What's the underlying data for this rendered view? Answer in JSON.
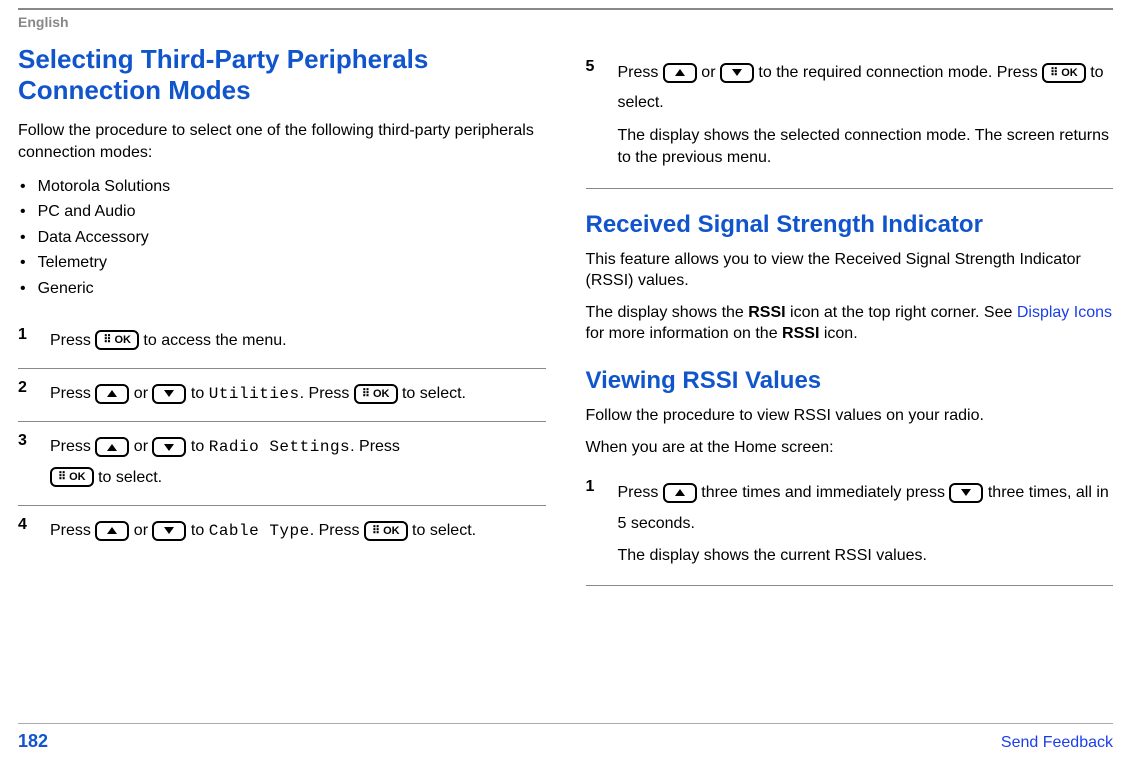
{
  "header": {
    "language": "English"
  },
  "left": {
    "h1_line1": "Selecting Third-Party Peripherals",
    "h1_line2": "Connection Modes",
    "intro": "Follow the procedure to select one of the following third-party peripherals connection modes:",
    "bullets": [
      "Motorola Solutions",
      "PC and Audio",
      "Data Accessory",
      "Telemetry",
      "Generic"
    ],
    "steps": {
      "s1": {
        "num": "1",
        "pre": "Press ",
        "ok": "⠿ OK",
        "post": " to access the menu."
      },
      "s2": {
        "num": "2",
        "pre": "Press ",
        "mid": " or ",
        "to": " to ",
        "menu": "Utilities",
        "dotpress": ". Press ",
        "ok": "⠿ OK",
        "post": " to select."
      },
      "s3": {
        "num": "3",
        "pre": "Press ",
        "mid": " or ",
        "to": " to ",
        "menu": "Radio Settings",
        "dotpress": ". Press",
        "ok": "⠿ OK",
        "post": " to select."
      },
      "s4": {
        "num": "4",
        "pre": "Press ",
        "mid": " or ",
        "to": " to ",
        "menu": "Cable Type",
        "dotpress": ". Press ",
        "ok": "⠿ OK",
        "post": " to select."
      }
    }
  },
  "right": {
    "step5": {
      "num": "5",
      "pre": "Press ",
      "mid": " or ",
      "to": " to the required connection mode. Press ",
      "ok": "⠿ OK",
      "post": " to select.",
      "note": "The display shows the selected connection mode. The screen returns to the previous menu."
    },
    "h2": "Received Signal Strength Indicator",
    "p1": "This feature allows you to view the Received Signal Strength Indicator (RSSI) values.",
    "p2a": "The display shows the ",
    "p2b": "RSSI",
    "p2c": " icon at the top right corner. See ",
    "p2link": "Display Icons",
    "p2d": " for more information on the ",
    "p2e": "RSSI",
    "p2f": " icon.",
    "h3": "Viewing RSSI Values",
    "p3": "Follow the procedure to view RSSI values on your radio.",
    "p4": "When you are at the Home screen:",
    "rstep1": {
      "num": "1",
      "pre": "Press ",
      "mid": " three times and immediately press ",
      "post": " three times, all in 5 seconds.",
      "note": "The display shows the current RSSI values."
    }
  },
  "icons": {
    "ok_label": "⠿ OK"
  },
  "footer": {
    "page": "182",
    "feedback": "Send Feedback"
  }
}
